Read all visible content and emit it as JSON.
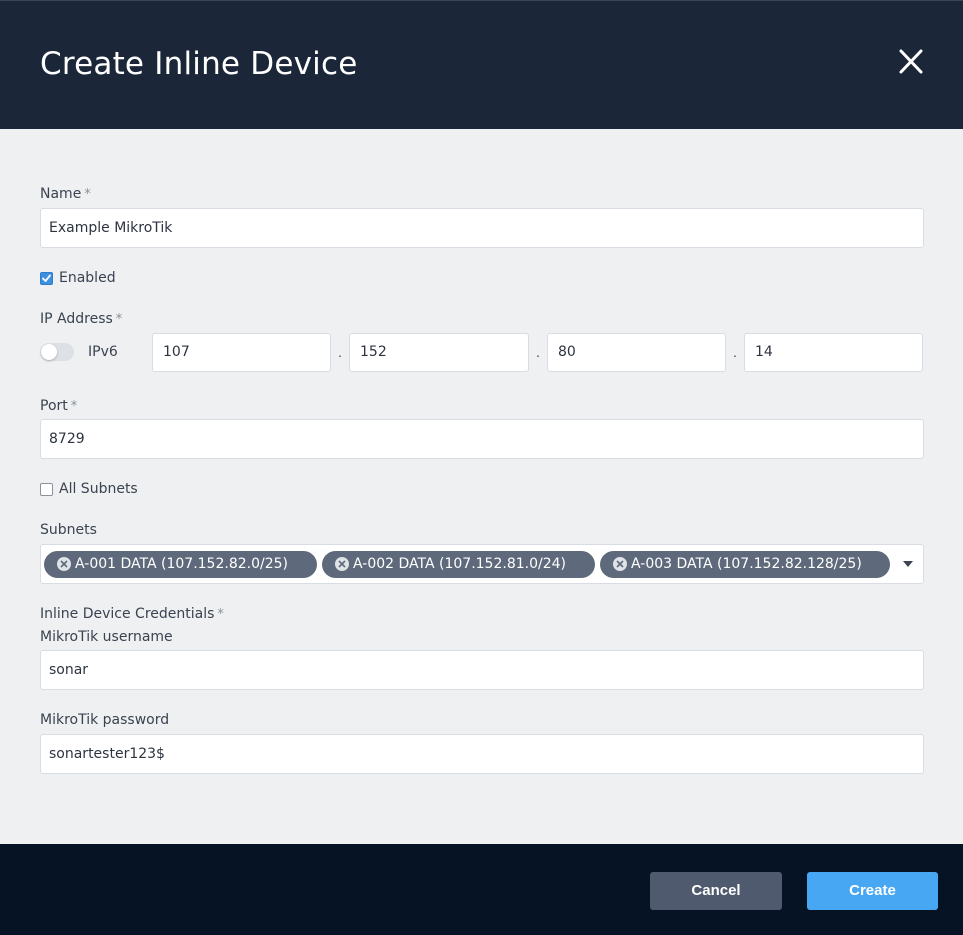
{
  "modal": {
    "title": "Create Inline Device",
    "close_icon": "close-icon"
  },
  "form": {
    "name": {
      "label": "Name",
      "required_mark": "*",
      "value": "Example MikroTik"
    },
    "enabled": {
      "label": "Enabled",
      "checked": true
    },
    "ip_address": {
      "label": "IP Address",
      "required_mark": "*",
      "ipv6_label": "IPv6",
      "ipv6_enabled": false,
      "separator": ".",
      "octets": [
        "107",
        "152",
        "80",
        "14"
      ]
    },
    "port": {
      "label": "Port",
      "required_mark": "*",
      "value": "8729"
    },
    "all_subnets": {
      "label": "All Subnets",
      "checked": false
    },
    "subnets": {
      "label": "Subnets",
      "selected": [
        "A-001 DATA (107.152.82.0/25)",
        "A-002 DATA (107.152.81.0/24)",
        "A-003 DATA (107.152.82.128/25)"
      ],
      "chip_remove_icon": "remove-chip-icon",
      "dropdown_icon": "caret-down-icon"
    },
    "credentials": {
      "label": "Inline Device Credentials",
      "required_mark": "*",
      "username_label": "MikroTik username",
      "username": "sonar",
      "password_label": "MikroTik password",
      "password": "sonartester123$"
    }
  },
  "footer": {
    "cancel_label": "Cancel",
    "create_label": "Create"
  },
  "colors": {
    "header_bg": "#1b2738",
    "footer_bg": "#061325",
    "body_bg": "#eef0f2",
    "chip_bg": "#5e6a7b",
    "primary": "#48a7f3",
    "secondary": "#505a6f",
    "checkbox_checked": "#3d8fe0"
  }
}
